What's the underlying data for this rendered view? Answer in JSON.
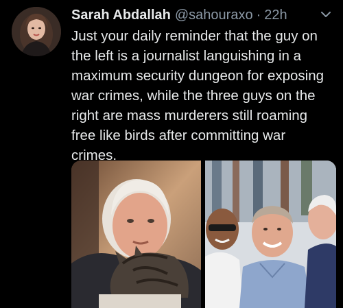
{
  "tweet": {
    "author_name": "Sarah Abdallah",
    "handle": "@sahouraxo",
    "separator": "·",
    "time": "22h",
    "text": "Just your daily reminder that the guy on\nthe left is a journalist languishing in a\nmaximum security dungeon for exposing\nwar crimes, while the three guys on the\nright are mass murderers still roaming\nfree like birds after committing war\ncrimes.",
    "menu_icon": "chevron-down-icon",
    "avatar_icon": "profile-avatar"
  },
  "media": {
    "left_photo": "photo-man-with-cat",
    "right_photo": "photo-three-men-smiling"
  },
  "colors": {
    "background": "#000000",
    "primary_text": "#e7e9ea",
    "secondary_text": "#8b98a5"
  }
}
